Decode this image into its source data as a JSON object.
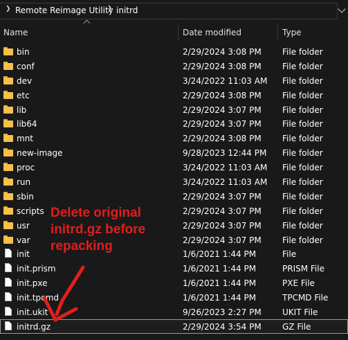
{
  "breadcrumb": {
    "segments": [
      "Remote Reimage Utility",
      "initrd"
    ]
  },
  "columns": {
    "name": "Name",
    "date": "Date modified",
    "type": "Type"
  },
  "files": [
    {
      "name": "bin",
      "date": "2/29/2024 3:08 PM",
      "type": "File folder",
      "icon": "folder-icon"
    },
    {
      "name": "conf",
      "date": "2/29/2024 3:08 PM",
      "type": "File folder",
      "icon": "folder-icon"
    },
    {
      "name": "dev",
      "date": "3/24/2022 11:03 AM",
      "type": "File folder",
      "icon": "folder-icon"
    },
    {
      "name": "etc",
      "date": "2/29/2024 3:08 PM",
      "type": "File folder",
      "icon": "folder-icon"
    },
    {
      "name": "lib",
      "date": "2/29/2024 3:07 PM",
      "type": "File folder",
      "icon": "folder-icon"
    },
    {
      "name": "lib64",
      "date": "2/29/2024 3:07 PM",
      "type": "File folder",
      "icon": "folder-icon"
    },
    {
      "name": "mnt",
      "date": "2/29/2024 3:08 PM",
      "type": "File folder",
      "icon": "folder-icon"
    },
    {
      "name": "new-image",
      "date": "9/28/2023 12:44 PM",
      "type": "File folder",
      "icon": "folder-icon"
    },
    {
      "name": "proc",
      "date": "3/24/2022 11:03 AM",
      "type": "File folder",
      "icon": "folder-icon"
    },
    {
      "name": "run",
      "date": "3/24/2022 11:03 AM",
      "type": "File folder",
      "icon": "folder-icon"
    },
    {
      "name": "sbin",
      "date": "2/29/2024 3:07 PM",
      "type": "File folder",
      "icon": "folder-icon"
    },
    {
      "name": "scripts",
      "date": "2/29/2024 3:07 PM",
      "type": "File folder",
      "icon": "folder-icon"
    },
    {
      "name": "usr",
      "date": "2/29/2024 3:07 PM",
      "type": "File folder",
      "icon": "folder-icon"
    },
    {
      "name": "var",
      "date": "2/29/2024 3:07 PM",
      "type": "File folder",
      "icon": "folder-icon"
    },
    {
      "name": "init",
      "date": "1/6/2021 1:44 PM",
      "type": "File",
      "icon": "file-icon"
    },
    {
      "name": "init.prism",
      "date": "1/6/2021 1:44 PM",
      "type": "PRISM File",
      "icon": "file-icon"
    },
    {
      "name": "init.pxe",
      "date": "1/6/2021 1:44 PM",
      "type": "PXE File",
      "icon": "file-icon"
    },
    {
      "name": "init.tpcmd",
      "date": "1/6/2021 1:44 PM",
      "type": "TPCMD File",
      "icon": "file-icon"
    },
    {
      "name": "init.ukit",
      "date": "9/26/2023 2:27 PM",
      "type": "UKIT File",
      "icon": "file-icon"
    },
    {
      "name": "initrd.gz",
      "date": "2/29/2024 3:54 PM",
      "type": "GZ File",
      "icon": "file-icon",
      "selected": true
    }
  ],
  "annotation": {
    "lines": [
      "Delete original",
      "initrd.gz before",
      "repacking"
    ],
    "color": "#e01e1e"
  },
  "colors": {
    "background": "#191919",
    "folder": "#f5c04b",
    "text": "#ffffff"
  }
}
